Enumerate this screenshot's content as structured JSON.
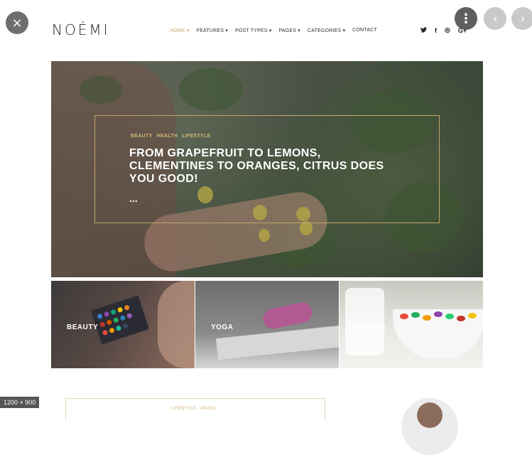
{
  "viewer": {
    "close_icon": "×",
    "more_icon": "⋮",
    "prev_icon": "‹",
    "next_icon": "›",
    "image_size": "1200 × 900"
  },
  "site": {
    "logo": "NOÉMI",
    "nav": [
      "HOME ▾",
      "FEATURES ▾",
      "POST TYPES ▾",
      "PAGES ▾",
      "CATEGORIES ▾",
      "CONTACT"
    ],
    "social": [
      "twitter-icon",
      "facebook-icon",
      "instagram-icon",
      "google-plus-icon"
    ],
    "social_glyphs": [
      "🐦",
      "f",
      "◎",
      "G+"
    ]
  },
  "hero": {
    "categories": [
      "BEAUTY",
      "HEALTH",
      "LIFESTYLE"
    ],
    "title": "FROM GRAPEFRUIT TO LEMONS, CLEMENTINES TO ORANGES, CITRUS DOES YOU GOOD!",
    "more": "..."
  },
  "tiles": [
    {
      "label": "BEAUTY"
    },
    {
      "label": "YOGA"
    },
    {
      "label": "HEALTH"
    }
  ],
  "next_card": {
    "categories": "LIFESTYLE · MUSIC"
  },
  "colors": {
    "accent": "#c9a86a"
  }
}
